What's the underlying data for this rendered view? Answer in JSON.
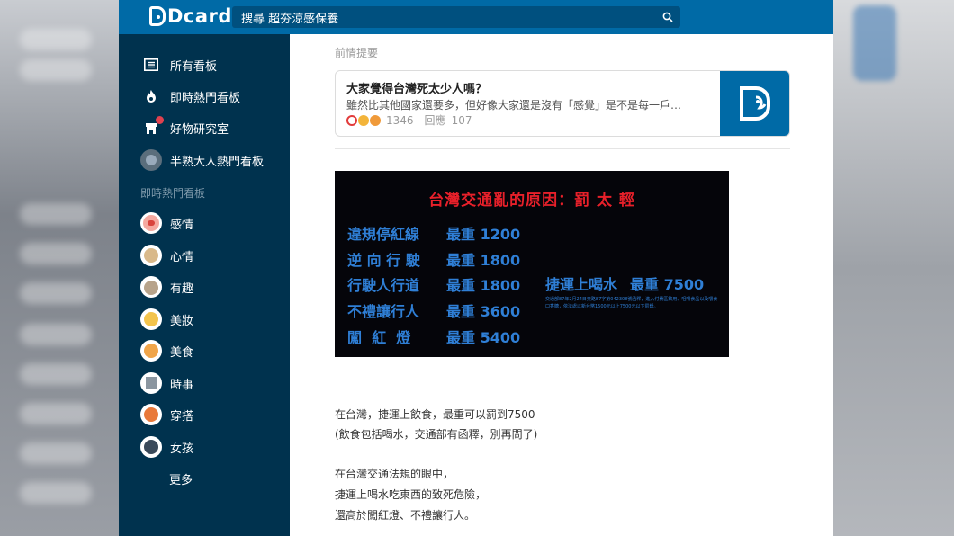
{
  "app": {
    "brand": "Dcard"
  },
  "search": {
    "value": "搜尋 超夯涼感保養"
  },
  "sidebar": {
    "nav": [
      {
        "label": "所有看板"
      },
      {
        "label": "即時熱門看板"
      },
      {
        "label": "好物研究室"
      },
      {
        "label": "半熟大人熱門看板"
      }
    ],
    "section_heading": "即時熱門看板",
    "boards": [
      {
        "label": "感情"
      },
      {
        "label": "心情"
      },
      {
        "label": "有趣"
      },
      {
        "label": "美妝"
      },
      {
        "label": "美食"
      },
      {
        "label": "時事"
      },
      {
        "label": "穿搭"
      },
      {
        "label": "女孩"
      }
    ],
    "more_label": "更多"
  },
  "post": {
    "recap_label": "前情提要",
    "recap": {
      "title": "大家覺得台灣死太少人嗎？",
      "excerpt": "雖然比其他國家還要多，但好像大家還是沒有「感覺」是不是每一戶…",
      "likes": "1346",
      "reply_label": "回應",
      "replies": "107"
    },
    "image": {
      "title": "台灣交通亂的原因：罰 太 輕",
      "fines": [
        {
          "label": "違規停紅線",
          "fine": "最重 1200"
        },
        {
          "label": "逆 向 行 駛",
          "fine": "最重 1800"
        },
        {
          "label": "行駛人行道",
          "fine": "最重 1800"
        },
        {
          "label": "不禮讓行人",
          "fine": "最重 3600"
        },
        {
          "label": "闖  紅  燈",
          "fine": "最重 5400"
        }
      ],
      "mrt_label": "捷運上喝水",
      "mrt_fine": "最重 7500",
      "mrt_note": "交通部87年2月24日交路87字第042308號函釋，進入付費區飲用、咀嚼食品以及嚼食口香糖，依法處以新台幣1500元以上7500元以下罰鍰。"
    },
    "paragraphs": [
      "在台灣，捷運上飲食，最重可以罰到7500",
      "(飲食包括喝水，交通部有函釋，別再問了)",
      "在台灣交通法規的眼中，",
      "捷運上喝水吃東西的致死危險，",
      "還高於闖紅燈、不禮讓行人。"
    ]
  },
  "colors": {
    "topbar": "#006aa6",
    "sidebar": "#00324e",
    "image_title": "#e8202a",
    "image_text": "#2f7fd6"
  }
}
